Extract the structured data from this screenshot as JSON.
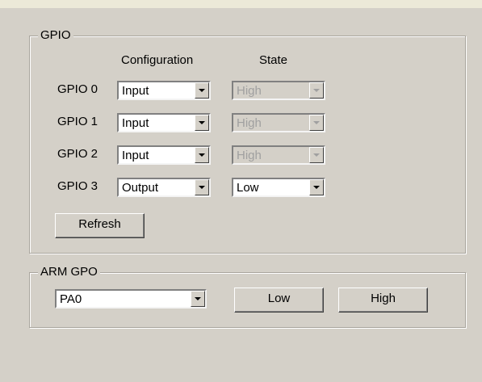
{
  "gpio_group": {
    "title": "GPIO",
    "config_header": "Configuration",
    "state_header": "State",
    "rows": [
      {
        "label": "GPIO 0",
        "config": "Input",
        "state": "High",
        "state_enabled": false
      },
      {
        "label": "GPIO 1",
        "config": "Input",
        "state": "High",
        "state_enabled": false
      },
      {
        "label": "GPIO 2",
        "config": "Input",
        "state": "High",
        "state_enabled": false
      },
      {
        "label": "GPIO 3",
        "config": "Output",
        "state": "Low",
        "state_enabled": true
      }
    ],
    "refresh_label": "Refresh"
  },
  "arm_group": {
    "title": "ARM GPO",
    "pin_value": "PA0",
    "low_label": "Low",
    "high_label": "High"
  },
  "icons": {
    "dropdown": "chevron-down-icon"
  },
  "colors": {
    "background": "#d4d0c8",
    "field": "#ffffff",
    "disabled_text": "#a0a0a0"
  }
}
